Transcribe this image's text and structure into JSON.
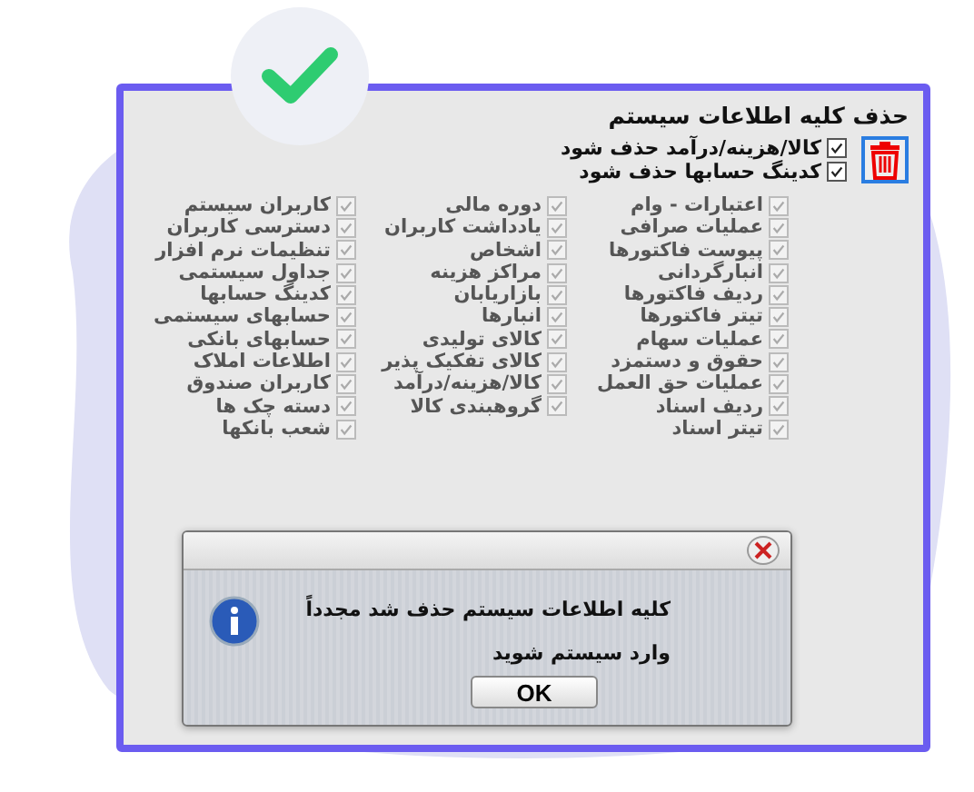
{
  "window": {
    "title": "حذف کلیه اطلاعات سیستم"
  },
  "options": [
    {
      "label": "کالا/هزینه/درآمد  حذف شود",
      "checked": true
    },
    {
      "label": "کدینگ حسابها حذف شود",
      "checked": true
    }
  ],
  "columns": [
    [
      {
        "label": "اعتبارات - وام",
        "checked": true,
        "disabled": true
      },
      {
        "label": "عملیات صرافی",
        "checked": true,
        "disabled": true
      },
      {
        "label": "پیوست فاکتورها",
        "checked": true,
        "disabled": true
      },
      {
        "label": "انبارگردانی",
        "checked": true,
        "disabled": true
      },
      {
        "label": "ردیف فاکتورها",
        "checked": true,
        "disabled": true
      },
      {
        "label": "تیتر فاکتورها",
        "checked": true,
        "disabled": true
      },
      {
        "label": "عملیات سهام",
        "checked": true,
        "disabled": true
      },
      {
        "label": "حقوق و دستمزد",
        "checked": true,
        "disabled": true
      },
      {
        "label": "عملیات حق العمل",
        "checked": true,
        "disabled": true
      },
      {
        "label": "ردیف اسناد",
        "checked": true,
        "disabled": true
      },
      {
        "label": "تیتر اسناد",
        "checked": true,
        "disabled": true
      }
    ],
    [
      {
        "label": "دوره مالی",
        "checked": true,
        "disabled": true
      },
      {
        "label": "یادداشت کاربران",
        "checked": true,
        "disabled": true
      },
      {
        "label": "اشخاص",
        "checked": true,
        "disabled": true
      },
      {
        "label": "مراکز هزینه",
        "checked": true,
        "disabled": true
      },
      {
        "label": "بازاریابان",
        "checked": true,
        "disabled": true
      },
      {
        "label": "انبارها",
        "checked": true,
        "disabled": true
      },
      {
        "label": "کالای تولیدی",
        "checked": true,
        "disabled": true
      },
      {
        "label": "کالای تفکیک پذیر",
        "checked": true,
        "disabled": true
      },
      {
        "label": "کالا/هزینه/درآمد",
        "checked": true,
        "disabled": true
      },
      {
        "label": "گروهبندی کالا",
        "checked": true,
        "disabled": true
      }
    ],
    [
      {
        "label": "کاربران سیستم",
        "checked": true,
        "disabled": true
      },
      {
        "label": "دسترسی کاربران",
        "checked": true,
        "disabled": true
      },
      {
        "label": "تنظیمات نرم افزار",
        "checked": true,
        "disabled": true
      },
      {
        "label": "جداول سیستمی",
        "checked": true,
        "disabled": true
      },
      {
        "label": "کدینگ حسابها",
        "checked": true,
        "disabled": true
      },
      {
        "label": "حسابهای سیستمی",
        "checked": true,
        "disabled": true
      },
      {
        "label": "حسابهای بانکی",
        "checked": true,
        "disabled": true
      },
      {
        "label": "اطلاعات املاک",
        "checked": true,
        "disabled": true
      },
      {
        "label": "کاربران صندوق",
        "checked": true,
        "disabled": true
      },
      {
        "label": "دسته چک ها",
        "checked": true,
        "disabled": true
      },
      {
        "label": "شعب بانکها",
        "checked": true,
        "disabled": true
      }
    ]
  ],
  "dialog": {
    "lines": [
      "کلیه اطلاعات سیستم حذف شد مجدداً",
      "وارد سیستم شوید"
    ],
    "button": "OK"
  }
}
